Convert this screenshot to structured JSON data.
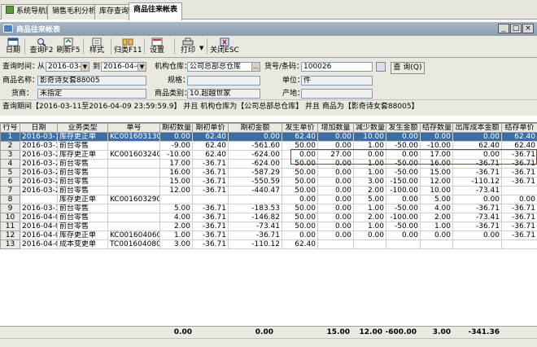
{
  "tabs": [
    {
      "label": "系统导航图",
      "active": false
    },
    {
      "label": "销售毛利分析",
      "active": false
    },
    {
      "label": "库存查询",
      "active": false
    },
    {
      "label": "商品往来帐表",
      "active": true
    }
  ],
  "window_title": "商品往来帐表",
  "toolbar": [
    {
      "label": "日期",
      "icon": "calendar-icon"
    },
    {
      "label": "查询F2",
      "icon": "search-icon"
    },
    {
      "label": "刷新F5",
      "icon": "refresh-icon"
    },
    {
      "label": "样式",
      "icon": "style-icon"
    },
    {
      "label": "归类F11",
      "icon": "group-icon"
    },
    {
      "label": "设置",
      "icon": "settings-icon"
    },
    {
      "label": "打印",
      "icon": "print-icon"
    },
    {
      "label": "关闭ESC",
      "icon": "close-icon"
    }
  ],
  "form": {
    "query_time_label": "查询时间：",
    "from_label": "从",
    "date_from": "2016-03-11",
    "to_label": "到",
    "date_to": "2016-04-09",
    "warehouse_label": "机构仓库：",
    "warehouse_value": "公司总部总仓库",
    "code_label": "货号/条码：",
    "code_value": "100026",
    "query_button": "查 询(Q)",
    "name_label": "商品名称：",
    "name_value": "影奇诗女套88005",
    "spec_label": "规格：",
    "spec_value": "",
    "unit_label": "单位：",
    "unit_value": "件",
    "shelf_label": "货商：",
    "shelf_value": "未指定",
    "category_label": "商品类别：",
    "category_value": "10.超越世家",
    "origin_label": "产地：",
    "origin_value": ""
  },
  "condition_text": "查询期间【2016-03-11至2016-04-09 23:59:59.9】 并且 机构仓库为【公司总部总仓库】 并且 商品为【影奇诗女套88005】",
  "columns": [
    "行号",
    "日期",
    "业务类型",
    "单号",
    "期初数量",
    "期初单价",
    "期初金额",
    "发生单价",
    "增加数量",
    "减少数量",
    "发生金额",
    "结存数量",
    "出库成本金额",
    "结存单价"
  ],
  "rows": [
    [
      "1",
      "2016-03-13",
      "库存更正单",
      "KC001603130001",
      "0.00",
      "62.40",
      "0.00",
      "62.40",
      "0.00",
      "10.00",
      "0.00",
      "0.00",
      "0.00",
      "62.40"
    ],
    [
      "2",
      "2016-03-14",
      "前台零售",
      "",
      "-9.00",
      "62.40",
      "-561.60",
      "50.00",
      "0.00",
      "1.00",
      "-50.00",
      "-10.00",
      "62.40",
      "62.40"
    ],
    [
      "3",
      "2016-03-24",
      "库存更正单",
      "KC001603240002",
      "-10.00",
      "62.40",
      "-624.00",
      "0.00",
      "27.00",
      "0.00",
      "0.00",
      "17.00",
      "0.00",
      "-36.71"
    ],
    [
      "4",
      "2016-03-26",
      "前台零售",
      "",
      "17.00",
      "-36.71",
      "-624.00",
      "50.00",
      "0.00",
      "1.00",
      "-50.00",
      "16.00",
      "-36.71",
      "-36.71"
    ],
    [
      "5",
      "2016-03-27",
      "前台零售",
      "",
      "16.00",
      "-36.71",
      "-587.29",
      "50.00",
      "0.00",
      "1.00",
      "-50.00",
      "15.00",
      "-36.71",
      "-36.71"
    ],
    [
      "6",
      "2016-03-28",
      "前台零售",
      "",
      "15.00",
      "-36.71",
      "-550.59",
      "50.00",
      "0.00",
      "3.00",
      "-150.00",
      "12.00",
      "-110.12",
      "-36.71"
    ],
    [
      "7",
      "2016-03-29",
      "前台零售",
      "",
      "12.00",
      "-36.71",
      "-440.47",
      "50.00",
      "0.00",
      "2.00",
      "-100.00",
      "10.00",
      "-73.41",
      ""
    ],
    [
      "8",
      "",
      "库存更正单",
      "KC001603290001",
      "",
      "",
      "",
      "0.00",
      "0.00",
      "5.00",
      "0.00",
      "5.00",
      "0.00",
      "0.00"
    ],
    [
      "9",
      "2016-03-30",
      "前台零售",
      "",
      "5.00",
      "-36.71",
      "-183.53",
      "50.00",
      "0.00",
      "1.00",
      "-50.00",
      "4.00",
      "-36.71",
      "-36.71"
    ],
    [
      "10",
      "2016-04-01",
      "前台零售",
      "",
      "4.00",
      "-36.71",
      "-146.82",
      "50.00",
      "0.00",
      "2.00",
      "-100.00",
      "2.00",
      "-73.41",
      "-36.71"
    ],
    [
      "11",
      "2016-04-03",
      "前台零售",
      "",
      "2.00",
      "-36.71",
      "-73.41",
      "50.00",
      "0.00",
      "1.00",
      "-50.00",
      "1.00",
      "-36.71",
      "-36.71"
    ],
    [
      "12",
      "2016-04-06",
      "库存更正单",
      "KC001604060001",
      "1.00",
      "-36.71",
      "-36.71",
      "0.00",
      "0.00",
      "0.00",
      "0.00",
      "0.00",
      "0.00",
      "-36.71"
    ],
    [
      "13",
      "2016-04-08",
      "成本变更单",
      "TC001604080001",
      "3.00",
      "-36.71",
      "-110.12",
      "62.40",
      "",
      "",
      "",
      "",
      "",
      ""
    ]
  ],
  "selected_row": 0,
  "totals": {
    "qty_begin": "0.00",
    "amount_begin": "0.00",
    "increase": "15.00",
    "decrease": "12.00",
    "amount": "-600.00",
    "balance": "3.00",
    "cost": "-341.36"
  }
}
